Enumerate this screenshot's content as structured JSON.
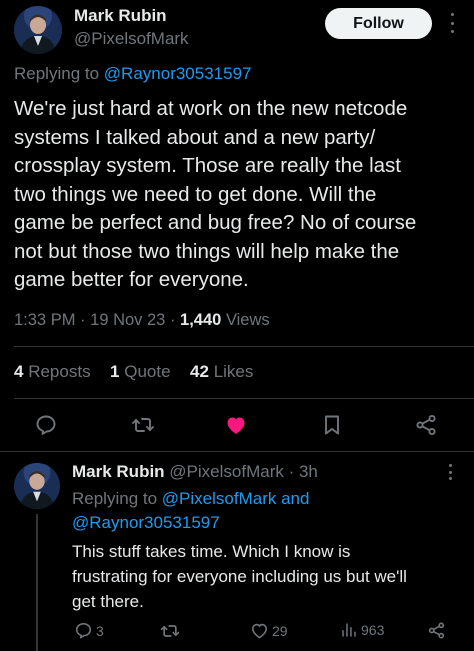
{
  "main_tweet": {
    "author_name": "Mark Rubin",
    "author_handle": "@PixelsofMark",
    "follow_label": "Follow",
    "replying_prefix": "Replying to",
    "replying_to": "@Raynor30531597",
    "text_lines": [
      "We're just hard at work on the new netcode",
      "systems I talked about and a new party/",
      "crossplay system. Those are really the last",
      "two things we need to get done. Will the",
      "game be perfect and bug free? No of course",
      "not but those two things will help make the",
      "game better for everyone."
    ],
    "time": "1:33 PM",
    "date": "19 Nov 23",
    "views_count": "1,440",
    "views_label": "Views",
    "reposts_count": "4",
    "reposts_label": "Reposts",
    "quotes_count": "1",
    "quotes_label": "Quote",
    "likes_count": "42",
    "likes_label": "Likes"
  },
  "reply_tweet": {
    "author_name": "Mark Rubin",
    "author_handle": "@PixelsofMark",
    "age": "3h",
    "replying_prefix": "Replying to",
    "replying_to_1": "@PixelsofMark",
    "and_word": "and",
    "replying_to_2": "@Raynor30531597",
    "text_lines": [
      "This stuff takes time. Which I know is",
      "frustrating for everyone including us but we'll",
      "get there."
    ],
    "reply_count": "3",
    "like_count": "29",
    "view_count": "963"
  },
  "colors": {
    "background": "#000000",
    "text": "#e7e9ea",
    "muted": "#71767b",
    "link": "#1d9bf0",
    "like_active": "#f91880",
    "divider": "#2f3336"
  },
  "icons": [
    "avatar",
    "more-icon",
    "reply-icon",
    "repost-icon",
    "like-icon-filled",
    "bookmark-icon",
    "share-icon",
    "like-icon",
    "views-icon"
  ]
}
